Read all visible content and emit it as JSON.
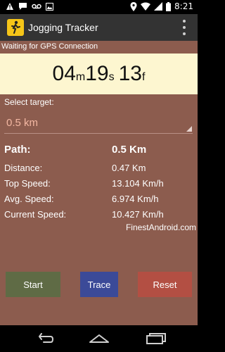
{
  "status_bar": {
    "time": "8:21",
    "left_icons": [
      "warning-icon",
      "chat-icon",
      "voicemail-icon",
      "gallery-icon"
    ],
    "right_icons": [
      "location-icon",
      "wifi-icon",
      "signal-icon",
      "battery-icon"
    ]
  },
  "action_bar": {
    "title": "Jogging Tracker",
    "app_icon": "runner-icon",
    "menu_icon": "overflow-menu-icon"
  },
  "gps_status": "Waiting for GPS Connection",
  "timer": {
    "minutes": "04",
    "minutes_unit": "m",
    "seconds": "19",
    "seconds_unit": "s",
    "fraction": "13",
    "fraction_unit": "f"
  },
  "target": {
    "label": "Select target:",
    "selected": "0.5 km"
  },
  "stats": {
    "path": {
      "label": "Path:",
      "value": "0.5 Km"
    },
    "distance": {
      "label": "Distance:",
      "value": "0.47 Km"
    },
    "top_speed": {
      "label": "Top Speed:",
      "value": "13.104 Km/h"
    },
    "avg_speed": {
      "label": "Avg. Speed:",
      "value": "6.974 Km/h"
    },
    "current_speed": {
      "label": "Current Speed:",
      "value": "10.427 Km/h"
    }
  },
  "credit": "FinestAndroid.com",
  "buttons": {
    "start": "Start",
    "trace": "Trace",
    "reset": "Reset"
  },
  "nav_bar": {
    "back_icon": "back-icon",
    "home_icon": "home-icon",
    "recents_icon": "recents-icon"
  },
  "colors": {
    "background": "#8c5c4e",
    "timer_panel": "#fdf6d0",
    "start": "#5f6b45",
    "trace": "#3b4a98",
    "reset": "#b34f43"
  }
}
